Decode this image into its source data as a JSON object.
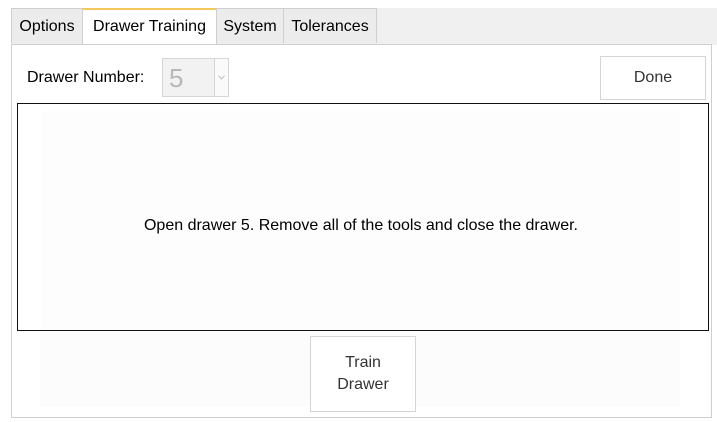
{
  "tabs": [
    {
      "label": "Options",
      "active": false
    },
    {
      "label": "Drawer Training",
      "active": true
    },
    {
      "label": "System",
      "active": false
    },
    {
      "label": "Tolerances",
      "active": false
    }
  ],
  "drawer": {
    "label": "Drawer Number:",
    "value": "5",
    "enabled": false
  },
  "done_label": "Done",
  "message": "Open drawer 5.  Remove all of the tools and close the drawer.",
  "train": {
    "line1": "Train",
    "line2": "Drawer"
  },
  "colors": {
    "active_tab_accent": "#f3c95e",
    "disabled_text": "#b8b8b8",
    "border": "#cfcfcf"
  },
  "icons": {
    "dropdown": "chevron-down-icon"
  }
}
